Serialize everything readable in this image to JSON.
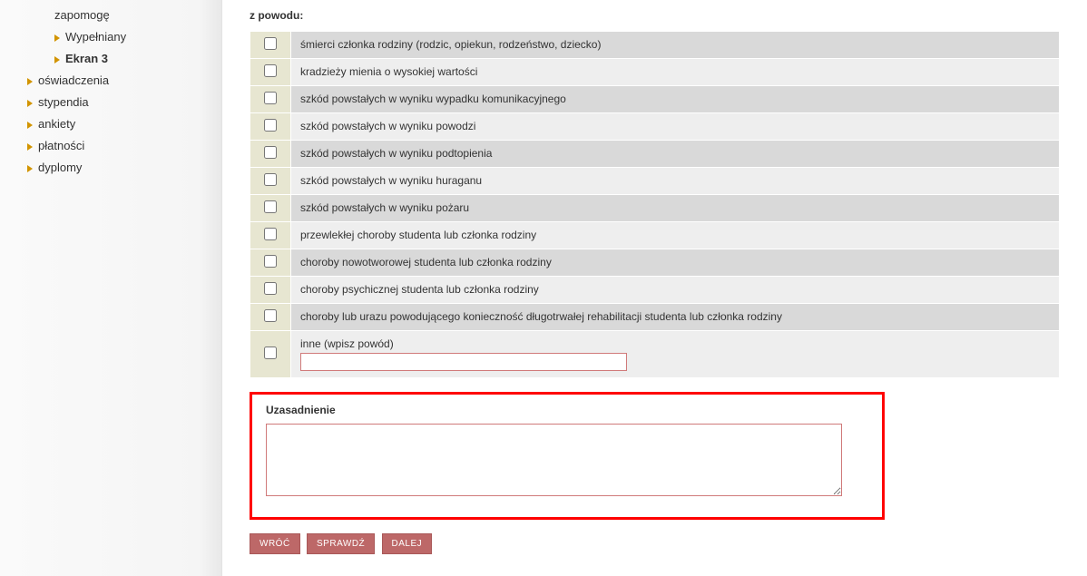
{
  "sidebar": {
    "items": [
      {
        "label": "zapomogę",
        "level": "lvl3",
        "active": false,
        "arrow": false
      },
      {
        "label": "Wypełniany",
        "level": "lvl3",
        "active": false,
        "arrow": true
      },
      {
        "label": "Ekran 3",
        "level": "lvl3",
        "active": true,
        "arrow": true
      },
      {
        "label": "oświadczenia",
        "level": "lvl1",
        "active": false,
        "arrow": true
      },
      {
        "label": "stypendia",
        "level": "lvl1",
        "active": false,
        "arrow": true
      },
      {
        "label": "ankiety",
        "level": "lvl1",
        "active": false,
        "arrow": true
      },
      {
        "label": "płatności",
        "level": "lvl1",
        "active": false,
        "arrow": true
      },
      {
        "label": "dyplomy",
        "level": "lvl1",
        "active": false,
        "arrow": true
      }
    ]
  },
  "main": {
    "section_label": "z powodu:",
    "reasons": [
      "śmierci członka rodziny (rodzic, opiekun, rodzeństwo, dziecko)",
      "kradzieży mienia o wysokiej wartości",
      "szkód powstałych w wyniku wypadku komunikacyjnego",
      "szkód powstałych w wyniku powodzi",
      "szkód powstałych w wyniku podtopienia",
      "szkód powstałych w wyniku huraganu",
      "szkód powstałych w wyniku pożaru",
      "przewlekłej choroby studenta lub członka rodziny",
      "choroby nowotworowej studenta lub członka rodziny",
      "choroby psychicznej studenta lub członka rodziny",
      "choroby lub urazu powodującego konieczność długotrwałej rehabilitacji studenta lub członka rodziny"
    ],
    "other_label": "inne (wpisz powód)",
    "other_value": "",
    "justify_title": "Uzasadnienie",
    "justify_value": "",
    "buttons": {
      "back": "WRÓĆ",
      "check": "SPRAWDŹ",
      "next": "DALEJ"
    }
  }
}
